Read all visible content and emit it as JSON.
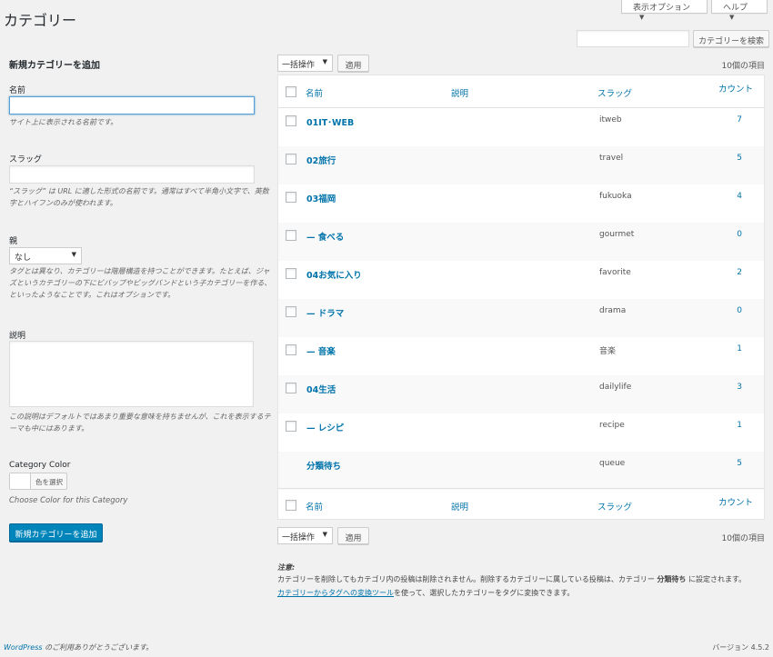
{
  "header": {
    "title": "カテゴリー",
    "screen_options": "表示オプション",
    "help": "ヘルプ"
  },
  "search": {
    "placeholder": "",
    "button": "カテゴリーを検索"
  },
  "form": {
    "heading": "新規カテゴリーを追加",
    "name_label": "名前",
    "name_desc": "サイト上に表示される名前です。",
    "slug_label": "スラッグ",
    "slug_desc": "“スラッグ” は URL に適した形式の名前です。通常はすべて半角小文字で、英数字とハイフンのみが使われます。",
    "parent_label": "親",
    "parent_value": "なし",
    "parent_desc": "タグとは異なり、カテゴリーは階層構造を持つことができます。たとえば、ジャズというカテゴリーの下にビバップやビッグバンドという子カテゴリーを作る、といったようなことです。これはオプションです。",
    "desc_label": "説明",
    "desc_desc": "この説明はデフォルトではあまり重要な意味を持ちませんが、これを表示するテーマも中にはあります。",
    "color_label": "Category Color",
    "color_button": "色を選択",
    "color_desc": "Choose Color for this Category",
    "submit": "新規カテゴリーを追加"
  },
  "bulk": {
    "label": "一括操作",
    "apply": "適用",
    "count": "10個の項目"
  },
  "table": {
    "columns": {
      "name": "名前",
      "desc": "説明",
      "slug": "スラッグ",
      "count": "カウント"
    },
    "rows": [
      {
        "name": "01IT･WEB",
        "slug": "itweb",
        "count": "7"
      },
      {
        "name": "02旅行",
        "slug": "travel",
        "count": "5"
      },
      {
        "name": "03福岡",
        "slug": "fukuoka",
        "count": "4"
      },
      {
        "name": "— 食べる",
        "slug": "gourmet",
        "count": "0"
      },
      {
        "name": "04お気に入り",
        "slug": "favorite",
        "count": "2"
      },
      {
        "name": "— ドラマ",
        "slug": "drama",
        "count": "0"
      },
      {
        "name": "— 音楽",
        "slug": "音楽",
        "count": "1"
      },
      {
        "name": "04生活",
        "slug": "dailylife",
        "count": "3"
      },
      {
        "name": "— レシピ",
        "slug": "recipe",
        "count": "1"
      },
      {
        "name": "分類待ち",
        "slug": "queue",
        "count": "5"
      }
    ]
  },
  "note": {
    "title": "注意:",
    "line1a": "カテゴリーを削除してもカテゴリ内の投稿は削除されません。削除するカテゴリーに属している投稿は、カテゴリー ",
    "line1b": "分類待ち",
    "line1c": " に設定されます。",
    "link": "カテゴリーからタグへの変換ツール",
    "line2": "を使って、選択したカテゴリーをタグに変換できます。"
  },
  "footer": {
    "wp_link": "WordPress",
    "thanks": " のご利用ありがとうございます。",
    "version": "バージョン 4.5.2"
  }
}
